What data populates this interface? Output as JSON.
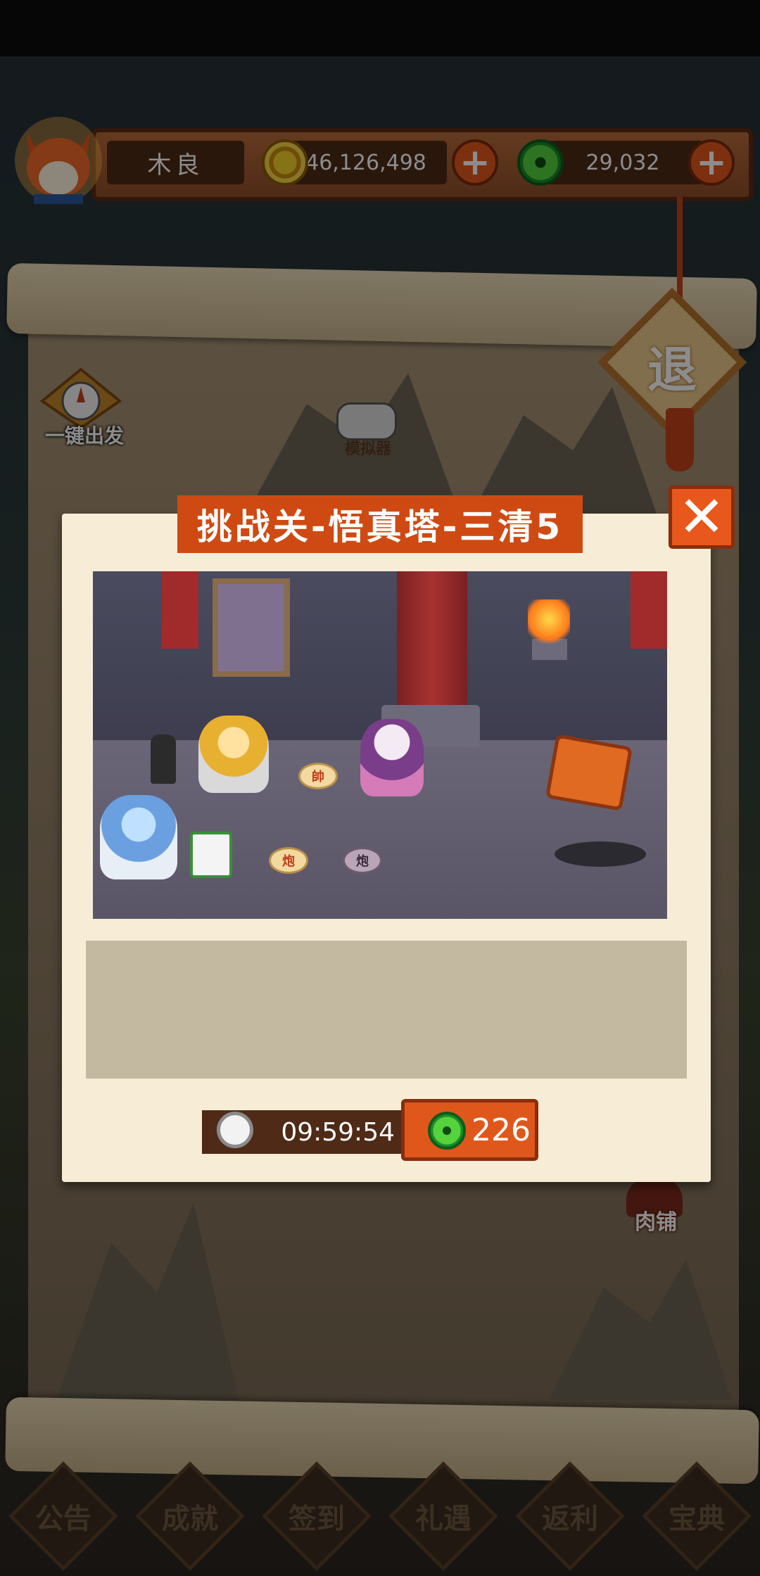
{
  "hud": {
    "player_name": "木良",
    "gold_amount": "46,126,498",
    "jade_amount": "29,032",
    "gold_plus": "+",
    "jade_plus": "+",
    "avatar_icon": "fox-avatar-icon",
    "gold_icon": "gold-coin-icon",
    "jade_icon": "jade-coin-icon"
  },
  "map": {
    "auto_depart_label": "一键出发",
    "emulator_label": "模拟器",
    "exit_label": "退",
    "shop_label": "肉铺"
  },
  "dialog": {
    "title": "挑战关-悟真塔-三清5",
    "close_label": "✕",
    "scene_pieces": {
      "shuai": "帥",
      "pao_red": "炮",
      "pao_black": "炮"
    },
    "timer": "09:59:54",
    "cost": "226",
    "timer_icon": "stopwatch-icon",
    "cost_icon": "jade-coin-icon"
  },
  "bottom_nav": {
    "items": [
      {
        "label": "公告"
      },
      {
        "label": "成就"
      },
      {
        "label": "签到"
      },
      {
        "label": "礼遇"
      },
      {
        "label": "返利"
      },
      {
        "label": "宝典"
      }
    ]
  },
  "colors": {
    "accent_orange": "#cf4a12",
    "panel_bg": "#f7edd6",
    "plate_brown": "#4e2a17"
  }
}
